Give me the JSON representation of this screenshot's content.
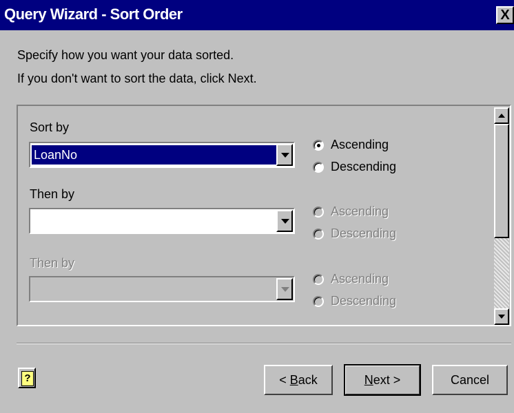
{
  "window": {
    "title": "Query Wizard - Sort Order",
    "close_label": "X"
  },
  "instructions": {
    "line1": "Specify how you want your data sorted.",
    "line2": "If you don't want to sort the data, click Next."
  },
  "sort_levels": [
    {
      "label": "Sort by",
      "value": "LoanNo",
      "enabled": true,
      "order": "Ascending",
      "ascending_label": "Ascending",
      "descending_label": "Descending"
    },
    {
      "label": "Then by",
      "value": "",
      "enabled": true,
      "order": null,
      "ascending_label": "Ascending",
      "descending_label": "Descending",
      "options_disabled": true
    },
    {
      "label": "Then by",
      "value": "",
      "enabled": false,
      "order": null,
      "ascending_label": "Ascending",
      "descending_label": "Descending",
      "options_disabled": true
    }
  ],
  "buttons": {
    "help": "?",
    "back_prefix": "< ",
    "back_mnemonic": "B",
    "back_rest": "ack",
    "next_mnemonic": "N",
    "next_rest": "ext >",
    "cancel": "Cancel"
  },
  "colors": {
    "titlebar": "#000080",
    "dialog_bg": "#c0c0c0",
    "selection": "#000080"
  }
}
